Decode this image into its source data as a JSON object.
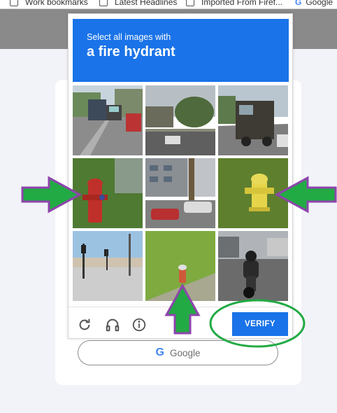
{
  "bookmarks_bar": {
    "items": [
      {
        "label": "Work bookmarks",
        "icon": "folder-icon"
      },
      {
        "label": "Latest Headlines",
        "icon": "folder-icon"
      },
      {
        "label": "Imported From Firef...",
        "icon": "folder-icon"
      },
      {
        "label": "Google",
        "icon": "google-icon"
      }
    ]
  },
  "captcha": {
    "prompt_line1": "Select all images with",
    "prompt_object": "a fire hydrant",
    "accent_color": "#1a73e8",
    "tiles": [
      {
        "id": 1,
        "content": "street with cars and bus"
      },
      {
        "id": 2,
        "content": "road with trees and cars"
      },
      {
        "id": 3,
        "content": "delivery truck on street"
      },
      {
        "id": 4,
        "content": "red fire hydrant on grass",
        "hydrant": true
      },
      {
        "id": 5,
        "content": "building with parked cars"
      },
      {
        "id": 6,
        "content": "yellow fire hydrant on grass",
        "hydrant": true
      },
      {
        "id": 7,
        "content": "intersection with traffic light"
      },
      {
        "id": 8,
        "content": "small fire hydrant on grass",
        "hydrant": true
      },
      {
        "id": 9,
        "content": "motorcycle rider on street"
      }
    ],
    "footer": {
      "reload_icon": "reload-icon",
      "audio_icon": "headphones-icon",
      "info_icon": "info-icon",
      "verify_label": "VERIFY"
    }
  },
  "google_signin": {
    "label": "Google",
    "icon": "google-g-icon"
  },
  "annotations": {
    "arrow_color": "#22aa44",
    "arrow_outline": "#8e44ad",
    "circle_color": "#22aa44"
  }
}
